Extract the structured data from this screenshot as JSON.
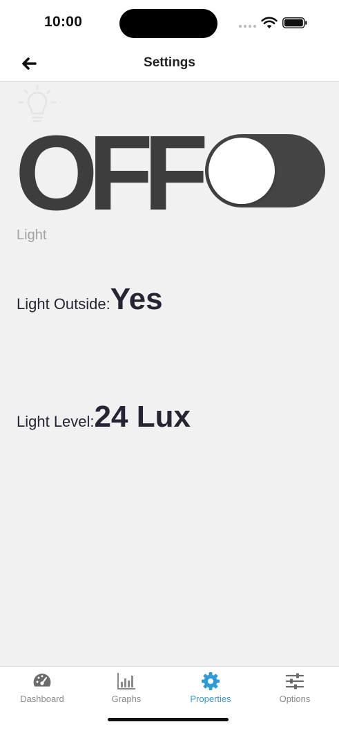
{
  "status_bar": {
    "time": "10:00",
    "icons": [
      "signal-icon",
      "wifi-icon",
      "battery-icon"
    ]
  },
  "nav": {
    "title": "Settings",
    "back_icon": "arrow-left-icon"
  },
  "light": {
    "icon": "lightbulb-icon",
    "state_text": "OFF",
    "toggle_on": false,
    "caption": "Light"
  },
  "properties": [
    {
      "label": "Light Outside:",
      "value": "Yes"
    },
    {
      "label": "Light Level:",
      "value": "24 Lux"
    }
  ],
  "tabs": [
    {
      "label": "Dashboard",
      "icon": "gauge-icon",
      "active": false
    },
    {
      "label": "Graphs",
      "icon": "bar-chart-icon",
      "active": false
    },
    {
      "label": "Properties",
      "icon": "gear-icon",
      "active": true
    },
    {
      "label": "Options",
      "icon": "sliders-icon",
      "active": false
    }
  ],
  "colors": {
    "accent": "#2e9bd6",
    "content_bg": "#f1f1f1",
    "toggle_off": "#444444",
    "value_text": "#262533"
  }
}
